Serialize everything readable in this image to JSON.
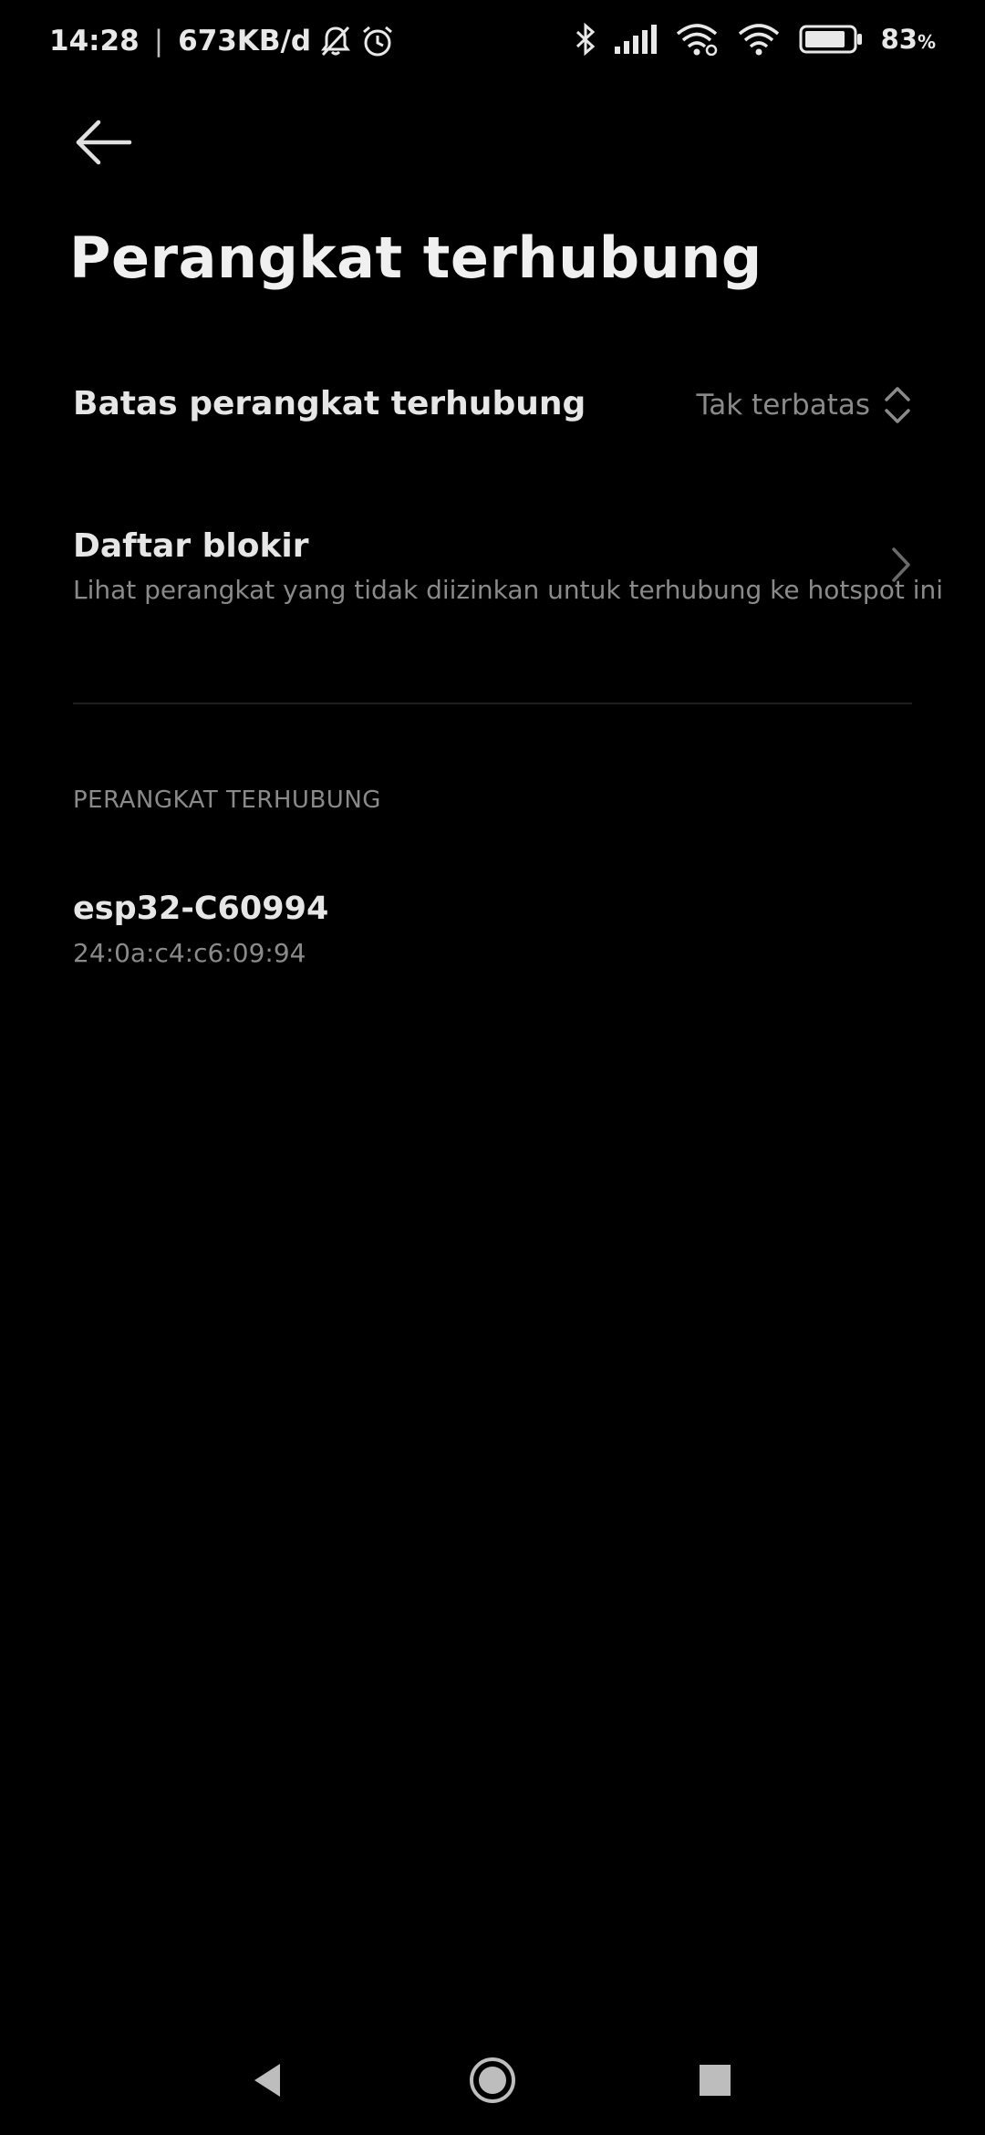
{
  "status_bar": {
    "time": "14:28",
    "separator": "|",
    "net_speed": "673KB/d",
    "battery_percent": "83",
    "battery_suffix": "%",
    "icons": [
      "bell-off-icon",
      "alarm-icon",
      "bluetooth-icon",
      "cell-signal-icon",
      "wifi-icon",
      "wifi-hotspot-icon",
      "battery-icon"
    ]
  },
  "header": {
    "back_icon": "arrow-left-icon",
    "title": "Perangkat terhubung"
  },
  "settings": {
    "limit": {
      "label": "Batas perangkat terhubung",
      "value": "Tak terbatas",
      "icon": "chevron-updown-icon"
    },
    "blocklist": {
      "title": "Daftar blokir",
      "subtitle": "Lihat perangkat yang tidak diizinkan untuk terhubung ke hotspot ini",
      "icon": "chevron-right-icon"
    }
  },
  "connected": {
    "section_title": "PERANGKAT TERHUBUNG",
    "devices": [
      {
        "name": "esp32-C60994",
        "mac": "24:0a:c4:c6:09:94"
      }
    ]
  },
  "navigation": {
    "icons": [
      "nav-back-icon",
      "nav-home-icon",
      "nav-recents-icon"
    ]
  },
  "colors": {
    "background": "#000000",
    "primary_text": "#e6e6e6",
    "secondary_text": "#8a8a8a",
    "divider": "#1e1e1e"
  }
}
